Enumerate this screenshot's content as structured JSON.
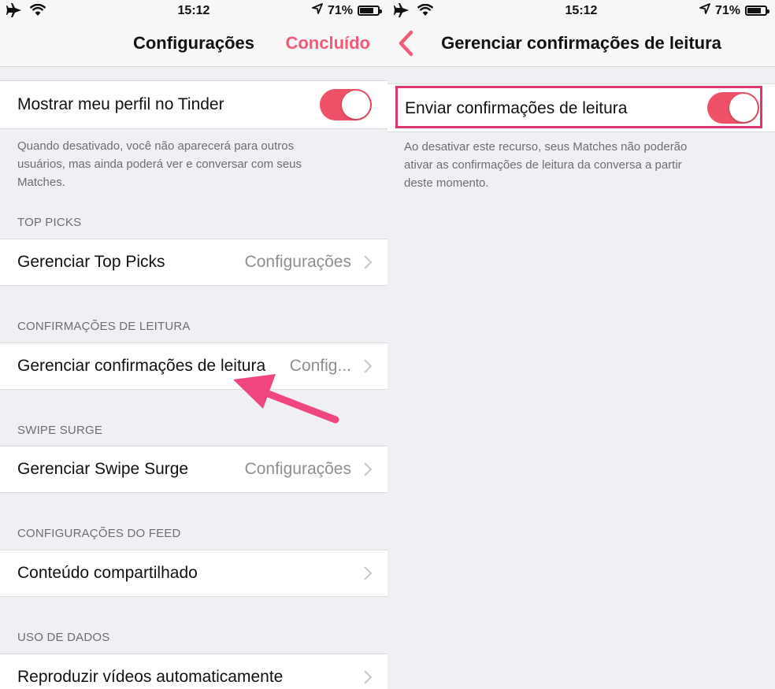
{
  "status_bar": {
    "time": "15:12",
    "battery": "71%",
    "battery_level": 0.71
  },
  "left": {
    "nav": {
      "title": "Configurações",
      "done_label": "Concluído"
    },
    "profile_toggle": {
      "label": "Mostrar meu perfil no Tinder",
      "on": true
    },
    "profile_note_lines": [
      "Quando desativado, você não aparecerá para outros",
      "usuários, mas ainda poderá ver e conversar com seus",
      "Matches."
    ],
    "sections": [
      {
        "header": "TOP PICKS",
        "row_label": "Gerenciar Top Picks",
        "row_value": "Configurações"
      },
      {
        "header": "CONFIRMAÇÕES DE LEITURA",
        "row_label": "Gerenciar confirmações de leitura",
        "row_value": "Config..."
      },
      {
        "header": "SWIPE SURGE",
        "row_label": "Gerenciar Swipe Surge",
        "row_value": "Configurações"
      },
      {
        "header": "CONFIGURAÇÕES DO FEED",
        "row_label": "Conteúdo compartilhado",
        "row_value": ""
      },
      {
        "header": "USO DE DADOS",
        "row_label": "Reproduzir vídeos automaticamente",
        "row_value": ""
      }
    ]
  },
  "right": {
    "nav": {
      "title": "Gerenciar confirmações de leitura"
    },
    "read_receipts_toggle": {
      "label": "Enviar confirmações de leitura",
      "on": true
    },
    "note_lines": [
      "Ao desativar este recurso, seus Matches não poderão",
      "ativar as confirmações de leitura da conversa a partir",
      "deste momento."
    ]
  },
  "colors": {
    "accent": "#f25a77",
    "toggle_on": "#ef5168",
    "annotation": "#f0467f",
    "highlight": "#e0366f"
  },
  "icons": {
    "airplane": "airplane-icon",
    "wifi": "wifi-icon",
    "location": "location-arrow-icon",
    "battery": "battery-icon",
    "chevron": "chevron-right-icon",
    "back": "back-chevron-icon"
  }
}
